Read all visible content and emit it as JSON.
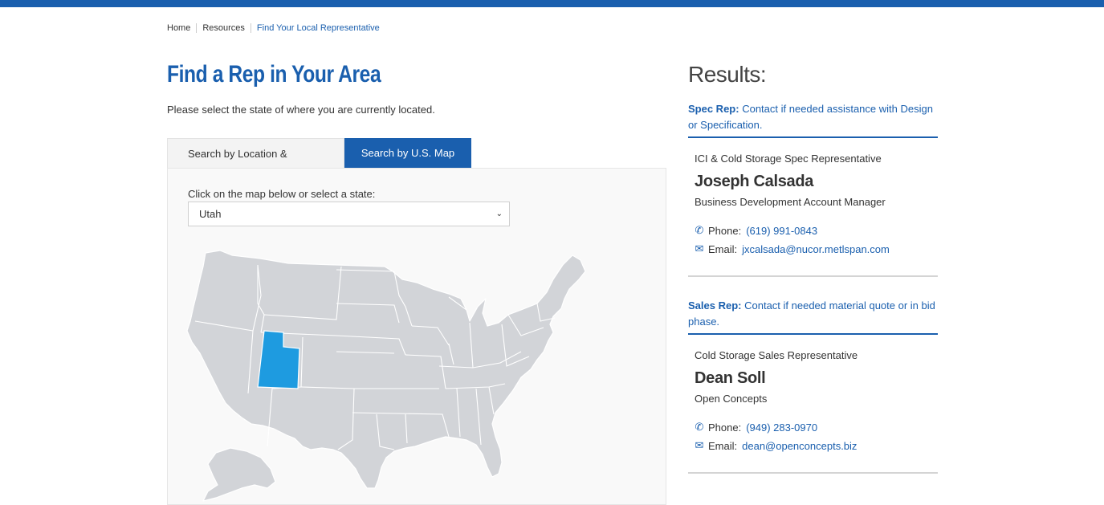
{
  "breadcrumb": {
    "home": "Home",
    "resources": "Resources",
    "current": "Find Your Local Representative"
  },
  "main": {
    "title": "Find a Rep in Your Area",
    "intro": "Please select the state of where you are currently located.",
    "tabs": [
      {
        "label": "Search by Location & Industry",
        "active": false
      },
      {
        "label": "Search by U.S. Map",
        "active": true
      }
    ],
    "map_prompt": "Click on the map below or select a state:",
    "selected_state": "Utah"
  },
  "colors": {
    "brand_blue": "#1a5fae",
    "state_default": "#d2d4d8",
    "state_selected": "#1e9be0"
  },
  "results": {
    "title": "Results:",
    "spec": {
      "heading_bold": "Spec Rep:",
      "heading_text": "Contact if needed assistance with Design or Specification.",
      "role": "ICI & Cold Storage Spec Representative",
      "name": "Joseph Calsada",
      "company": "Business Development Account Manager",
      "phone_label": "Phone:",
      "phone": "(619) 991-0843",
      "email_label": "Email:",
      "email": "jxcalsada@nucor.metlspan.com"
    },
    "sales": {
      "heading_bold": "Sales Rep:",
      "heading_text": "Contact if needed material quote or in bid phase.",
      "role": "Cold Storage Sales Representative",
      "name": "Dean Soll",
      "company": "Open Concepts",
      "phone_label": "Phone:",
      "phone": "(949) 283-0970",
      "email_label": "Email:",
      "email": "dean@openconcepts.biz"
    }
  }
}
